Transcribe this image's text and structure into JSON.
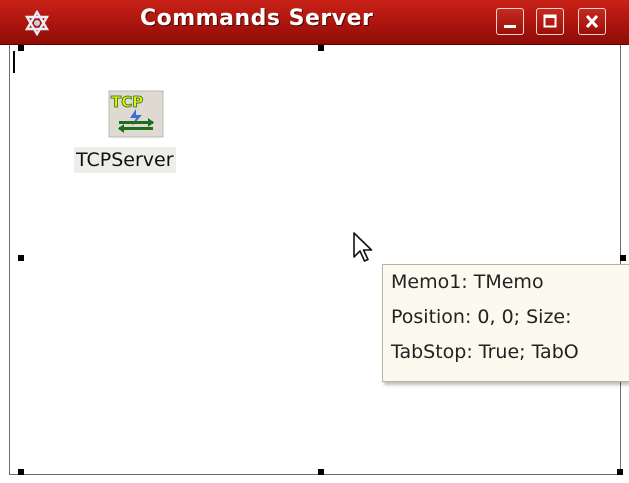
{
  "window": {
    "title": "Commands Server",
    "sysmenu_icon": "star-of-david-window-icon",
    "buttons": [
      "minimize",
      "maximize",
      "close"
    ],
    "accent_color": "#b0170f"
  },
  "designer": {
    "component": {
      "icon": "tcp-server-icon",
      "icon_text": "TCP",
      "label": "TCPServer"
    },
    "hint": {
      "line1": "Memo1: TMemo",
      "line2": "Position: 0, 0; Size:",
      "line3": "TabStop: True; TabO"
    }
  }
}
